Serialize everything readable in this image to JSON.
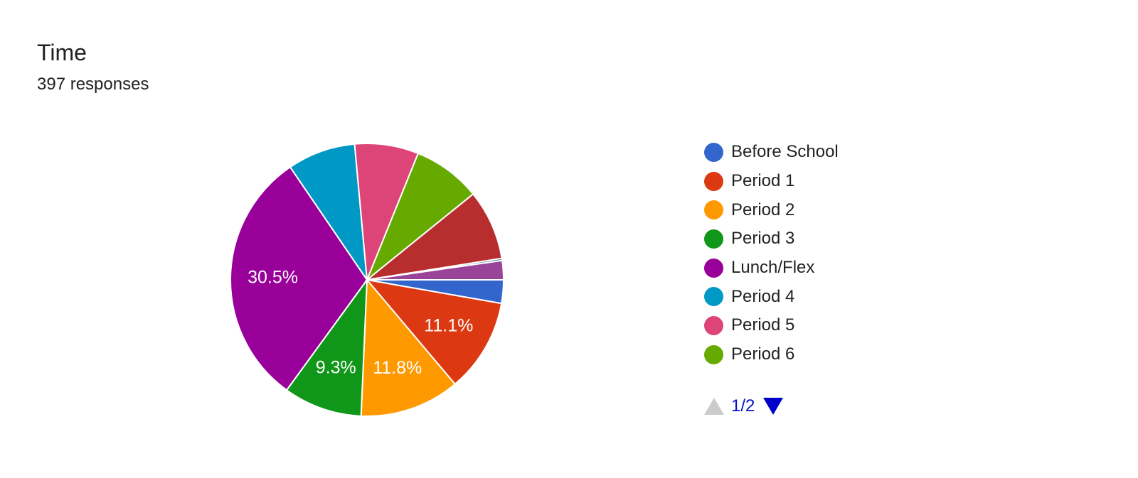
{
  "header": {
    "title": "Time",
    "responses": "397 responses"
  },
  "legend": {
    "page_indicator": "1/2",
    "up_icon": "triangle-up-icon",
    "down_icon": "triangle-down-icon",
    "up_color": "#cccccc",
    "down_color": "#0000cc"
  },
  "chart_data": {
    "type": "pie",
    "title": "Time",
    "subtitle": "397 responses",
    "total": 397,
    "start_angle_deg": 0,
    "direction": "clockwise",
    "legend_position": "right",
    "legend_page": "1/2",
    "slices": [
      {
        "label": "Before School",
        "value": 11,
        "percent_label": "",
        "color": "#3366cc",
        "in_legend_page": true
      },
      {
        "label": "Period 1",
        "value": 44,
        "percent_label": "11.1%",
        "color": "#dc3912",
        "in_legend_page": true
      },
      {
        "label": "Period 2",
        "value": 47,
        "percent_label": "11.8%",
        "color": "#ff9900",
        "in_legend_page": true
      },
      {
        "label": "Period 3",
        "value": 37,
        "percent_label": "9.3%",
        "color": "#109618",
        "in_legend_page": true
      },
      {
        "label": "Lunch/Flex",
        "value": 121,
        "percent_label": "30.5%",
        "color": "#990099",
        "in_legend_page": true
      },
      {
        "label": "Period 4",
        "value": 32,
        "percent_label": "",
        "color": "#0099c6",
        "in_legend_page": true
      },
      {
        "label": "Period 5",
        "value": 30,
        "percent_label": "",
        "color": "#dd4477",
        "in_legend_page": true
      },
      {
        "label": "Period 6",
        "value": 32,
        "percent_label": "",
        "color": "#66aa00",
        "in_legend_page": true
      },
      {
        "label": "",
        "value": 33,
        "percent_label": "",
        "color": "#b82e2e",
        "in_legend_page": false
      },
      {
        "label": "",
        "value": 1,
        "percent_label": "",
        "color": "#316395",
        "in_legend_page": false
      },
      {
        "label": "",
        "value": 9,
        "percent_label": "",
        "color": "#994499",
        "in_legend_page": false
      }
    ]
  }
}
